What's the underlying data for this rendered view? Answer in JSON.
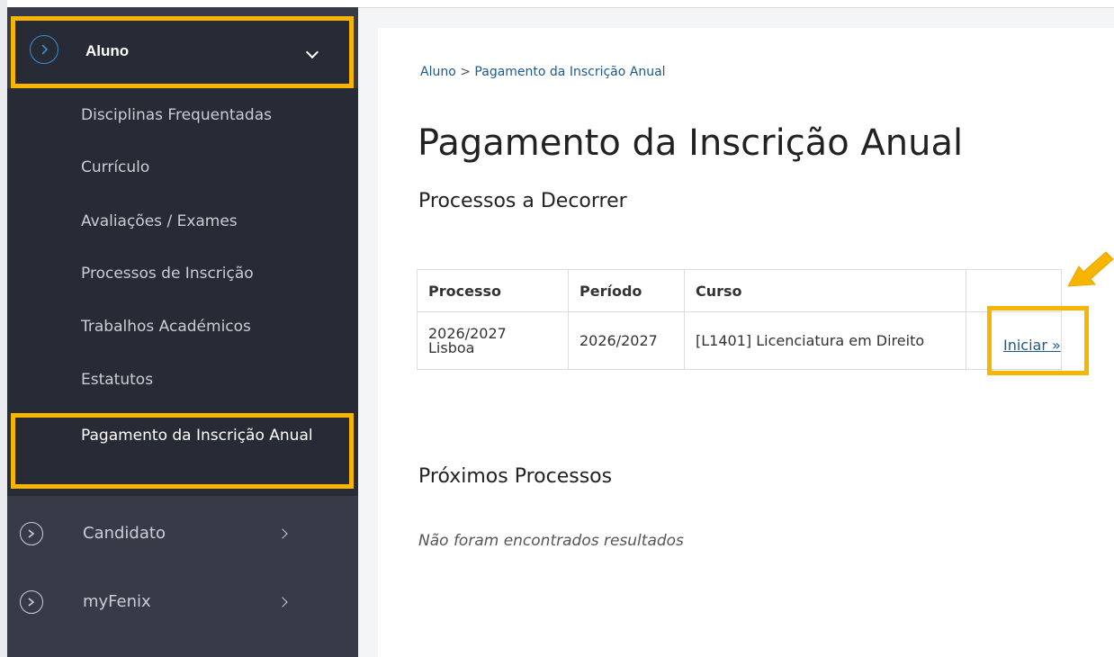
{
  "sidebar": {
    "header": {
      "label": "Aluno"
    },
    "sub_items": [
      "Disciplinas Frequentadas",
      "Currículo",
      "Avaliações / Exames",
      "Processos de Inscrição",
      "Trabalhos Académicos",
      "Estatutos"
    ],
    "active_item": "Pagamento da Inscrição Anual",
    "other_sections": [
      "Candidato",
      "myFenix"
    ]
  },
  "breadcrumb": {
    "parent": "Aluno",
    "separator": ">",
    "current": "Pagamento da Inscrição Anual"
  },
  "page_title": "Pagamento da Inscrição Anual",
  "current_processes": {
    "title": "Processos a Decorrer",
    "headers": [
      "Processo",
      "Período",
      "Curso",
      ""
    ],
    "rows": [
      {
        "processo": "2026/2027 Lisboa",
        "periodo": "2026/2027",
        "curso": "[L1401] Licenciatura em Direito",
        "action": "Iniciar »"
      }
    ]
  },
  "next_processes": {
    "title": "Próximos Processos",
    "empty_text": "Não foram encontrados resultados"
  },
  "colors": {
    "highlight": "#f7b500",
    "sidebar_bg": "#363b47",
    "link": "#1b5a8c"
  },
  "icons": {
    "section": "circle-chevron-icon",
    "expand": "chevron-down-icon",
    "collapse": "chevron-right-icon",
    "callout": "arrow-icon"
  }
}
